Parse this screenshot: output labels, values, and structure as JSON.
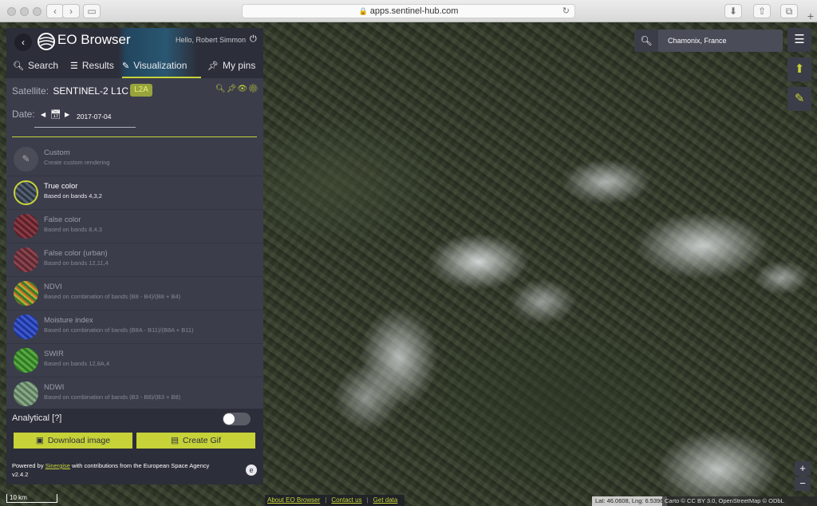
{
  "browser": {
    "url": "apps.sentinel-hub.com",
    "back": "‹",
    "forward": "›"
  },
  "panel": {
    "app_title": "EO Browser",
    "greeting": "Hello, Robert Simmon",
    "tabs": [
      {
        "label": "Search",
        "icon": "search-icon"
      },
      {
        "label": "Results",
        "icon": "sliders-icon"
      },
      {
        "label": "Visualization",
        "icon": "brush-icon"
      },
      {
        "label": "My pins",
        "icon": "pin-icon"
      }
    ],
    "satellite_label": "Satellite:",
    "satellite_name": "SENTINEL-2 L1C",
    "level_badge": "L2A",
    "date_label": "Date:",
    "date_value": "2017-07-04",
    "visualizations": [
      {
        "name": "Custom",
        "desc": "Create custom rendering",
        "color": "#4a4c58"
      },
      {
        "name": "True color",
        "desc": "Based on bands 4,3,2",
        "color": "#3a4250"
      },
      {
        "name": "False color",
        "desc": "Based on bands 8,4,3",
        "color": "#6a2a32"
      },
      {
        "name": "False color (urban)",
        "desc": "Based on bands 12,11,4",
        "color": "#6a3038"
      },
      {
        "name": "NDVI",
        "desc": "Based on combination of bands (B8 - B4)/(B8 + B4)",
        "color": "#4e8a36"
      },
      {
        "name": "Moisture index",
        "desc": "Based on combination of bands (B8A - B11)/(B8A + B11)",
        "color": "#2a3e9a"
      },
      {
        "name": "SWIR",
        "desc": "Based on bands 12,8A,4",
        "color": "#3c8a2e"
      },
      {
        "name": "NDWI",
        "desc": "Based on combination of bands (B3 - B8)/(B3 + B8)",
        "color": "#6a8a6a"
      }
    ],
    "analytical_label": "Analytical [?]",
    "download_label": "Download image",
    "gif_label": "Create Gif",
    "powered_prefix": "Powered by",
    "powered_link": "Sinergise",
    "powered_suffix": "with contributions from the European Space Agency",
    "version": "v2.4.2",
    "accent_color": "#c6d238"
  },
  "map": {
    "search_value": "Chamonix, France",
    "scale": "10 km",
    "links": [
      "About EO Browser",
      "Contact us",
      "Get data"
    ],
    "coords": "Lat: 46.0608, Lng: 6.5396",
    "attribution": "Carto © CC BY 3.0, OpenStreetMap © ODbL",
    "zoom_in": "+",
    "zoom_out": "−"
  }
}
